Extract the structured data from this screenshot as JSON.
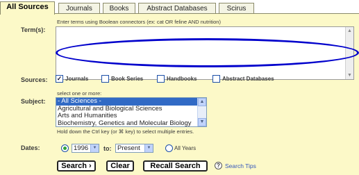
{
  "tabs": [
    {
      "label": "All Sources",
      "active": true
    },
    {
      "label": "Journals",
      "active": false
    },
    {
      "label": "Books",
      "active": false
    },
    {
      "label": "Abstract Databases",
      "active": false
    },
    {
      "label": "Scirus",
      "active": false
    }
  ],
  "terms": {
    "label": "Term(s):",
    "hint": "Enter terms using Boolean connectors (ex: cat OR feline AND nutrition)",
    "value": ""
  },
  "sources": {
    "label": "Sources:",
    "options": [
      {
        "label": "Journals",
        "checked": true
      },
      {
        "label": "Book Series",
        "checked": false
      },
      {
        "label": "Handbooks",
        "checked": false
      },
      {
        "label": "Abstract Databases",
        "checked": false
      }
    ]
  },
  "subject": {
    "label": "Subject:",
    "hint": "select one or more:",
    "options": [
      {
        "label": "- All Sciences -",
        "selected": true
      },
      {
        "label": "Agricultural and Biological Sciences",
        "selected": false
      },
      {
        "label": "Arts and Humanities",
        "selected": false
      },
      {
        "label": "Biochemistry, Genetics and Molecular Biology",
        "selected": false
      }
    ],
    "multi_hint": "Hold down the Ctrl key (or ⌘ key) to select multiple entries."
  },
  "dates": {
    "label": "Dates:",
    "from": "1996",
    "to_label": "to:",
    "to": "Present",
    "all_years": "All Years",
    "range_selected": true
  },
  "actions": {
    "search": "Search ›",
    "clear": "Clear",
    "recall": "Recall Search",
    "tips": "Search Tips"
  },
  "colors": {
    "panel_bg": "#fcf9c8",
    "selection": "#316ac5",
    "annotation_oval": "#0000cc",
    "link": "#3355bb"
  }
}
